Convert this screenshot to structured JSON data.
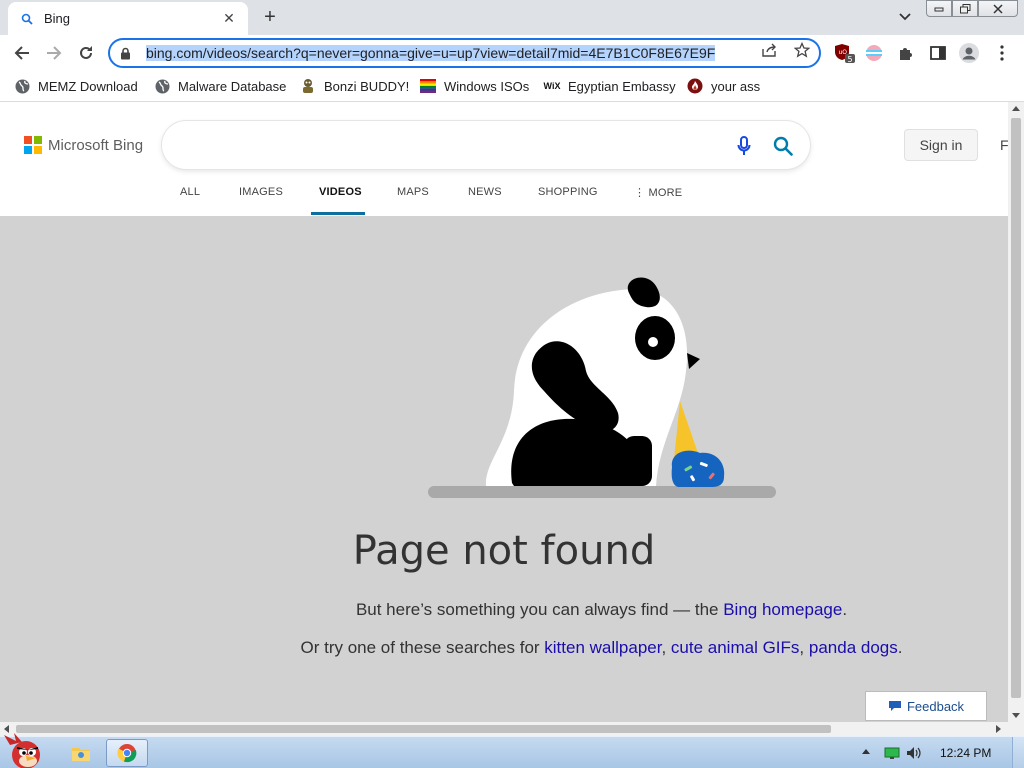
{
  "browser": {
    "tab": {
      "title": "Bing"
    },
    "omnibox": {
      "url": "bing.com/videos/search?q=never=gonna=give=u=up7view=detail7mid=4E7B1C0F8E67E9F"
    },
    "bookmarks": [
      {
        "label": "MEMZ Download",
        "icon": "globe-icon"
      },
      {
        "label": "Malware Database",
        "icon": "globe-icon"
      },
      {
        "label": "Bonzi BUDDY!",
        "icon": "bonzi-icon"
      },
      {
        "label": "Windows ISOs",
        "icon": "rainbow-flag-icon"
      },
      {
        "label": "Egyptian Embassy",
        "icon": "wix-icon"
      },
      {
        "label": "your ass",
        "icon": "fire-icon"
      }
    ],
    "extensions": {
      "badge_count": "5"
    }
  },
  "bing": {
    "logo_text": "Microsoft Bing",
    "search": {
      "value": "",
      "placeholder": ""
    },
    "sign_in": "Sign in",
    "edge_letter": "F",
    "scopes": [
      "ALL",
      "IMAGES",
      "VIDEOS",
      "MAPS",
      "NEWS",
      "SHOPPING",
      "MORE"
    ],
    "active_scope": "VIDEOS"
  },
  "error": {
    "title": "Page not found",
    "line1_prefix": "But here’s something you can always find — the ",
    "line1_link": "Bing homepage",
    "line1_suffix": ".",
    "line2_prefix": "Or try one of these searches for ",
    "line2_links": [
      "kitten wallpaper",
      "cute animal GIFs",
      "panda dogs"
    ],
    "sep": ", ",
    "line2_suffix": "."
  },
  "feedback_label": "Feedback",
  "taskbar": {
    "clock": "12:24 PM"
  },
  "colors": {
    "omnibox_focus": "#1a73e8",
    "link": "#1a0dab",
    "content_bg": "#d2d2d2",
    "active_scope_underline": "#0c6f9e"
  }
}
